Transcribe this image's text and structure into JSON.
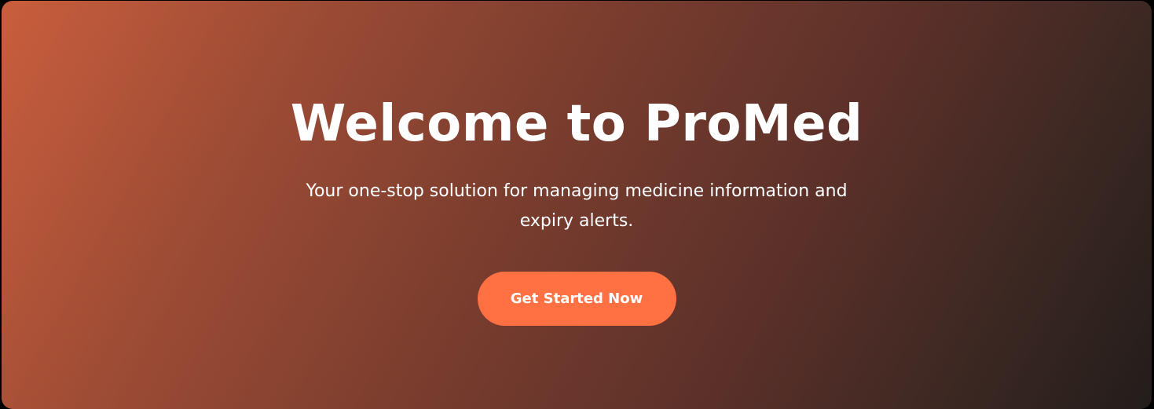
{
  "hero": {
    "title": "Welcome to ProMed",
    "subtitle": "Your one-stop solution for managing medicine information and expiry alerts.",
    "cta_label": "Get Started Now"
  },
  "colors": {
    "gradient_start": "#c95e3d",
    "gradient_end": "#231d1b",
    "button": "#ff7043",
    "text": "#ffffff"
  }
}
